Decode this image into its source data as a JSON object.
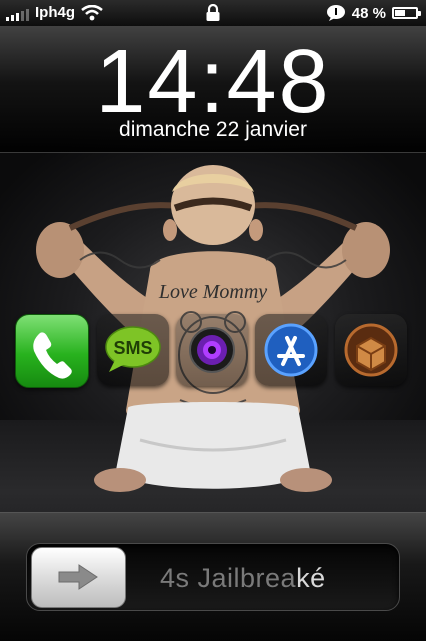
{
  "status_bar": {
    "carrier": "Iph4g",
    "battery_percent_text": "48 %",
    "battery_level": 0.48
  },
  "lock_screen": {
    "time": "14:48",
    "date": "dimanche 22 janvier"
  },
  "dock": {
    "icons": [
      {
        "name": "phone-icon"
      },
      {
        "name": "sms-icon",
        "label": "SMS"
      },
      {
        "name": "camera-icon"
      },
      {
        "name": "app-store-icon"
      },
      {
        "name": "cydia-icon"
      }
    ]
  },
  "wallpaper": {
    "tattoo_text": "Love Mommy"
  },
  "slider": {
    "label_dim": "4s Jailbrea",
    "label_bright": "ké"
  },
  "colors": {
    "phone_green": "#28b21e",
    "sms_green": "#7ec426",
    "appstore_blue": "#2a7de1",
    "cydia_brown": "#b86a2e"
  }
}
